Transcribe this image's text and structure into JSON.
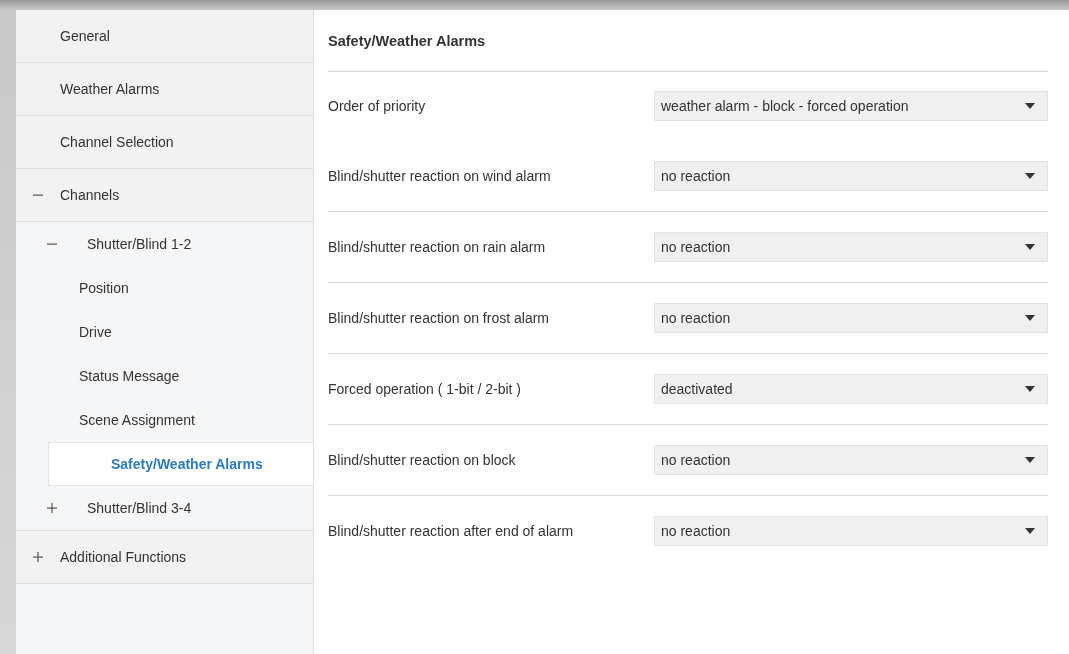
{
  "sidebar": {
    "items": [
      {
        "label": "General",
        "selected": false
      },
      {
        "label": "Weather Alarms",
        "selected": false
      },
      {
        "label": "Channel Selection",
        "selected": false
      },
      {
        "label": "Channels",
        "selected": false,
        "expanded": true,
        "children": [
          {
            "label": "Shutter/Blind 1-2",
            "selected": false,
            "expanded": true,
            "children": [
              {
                "label": "Position",
                "selected": false
              },
              {
                "label": "Drive",
                "selected": false
              },
              {
                "label": "Status Message",
                "selected": false
              },
              {
                "label": "Scene Assignment",
                "selected": false
              },
              {
                "label": "Safety/Weather Alarms",
                "selected": true
              }
            ]
          },
          {
            "label": "Shutter/Blind 3-4",
            "selected": false,
            "expanded": false
          }
        ]
      },
      {
        "label": "Additional Functions",
        "selected": false,
        "expanded": false
      }
    ]
  },
  "panel": {
    "title": "Safety/Weather Alarms",
    "rows": [
      {
        "label": "Order of priority",
        "value": "weather alarm - block - forced operation",
        "divider": false
      },
      {
        "label": "Blind/shutter reaction on wind alarm",
        "value": "no reaction",
        "divider": true
      },
      {
        "label": "Blind/shutter reaction on rain alarm",
        "value": "no reaction",
        "divider": true
      },
      {
        "label": "Blind/shutter reaction on frost alarm",
        "value": "no reaction",
        "divider": true
      },
      {
        "label": "Forced operation ( 1-bit / 2-bit )",
        "value": "deactivated",
        "divider": true
      },
      {
        "label": "Blind/shutter reaction on block",
        "value": "no reaction",
        "divider": true
      },
      {
        "label": "Blind/shutter reaction after end of alarm",
        "value": "no reaction",
        "divider": false
      }
    ]
  }
}
